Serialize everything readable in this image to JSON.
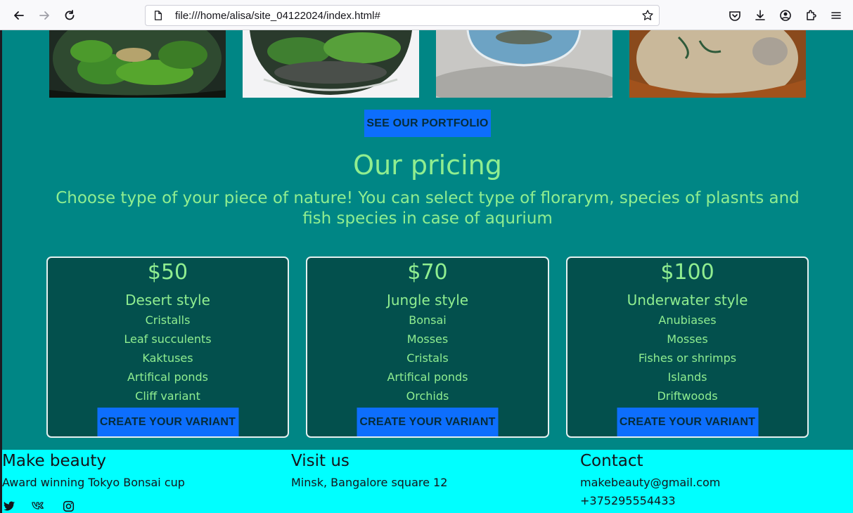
{
  "browser": {
    "url": "file:///home/alisa/site_04122024/index.html#"
  },
  "portfolio": {
    "button_label": "SEE OUR PORTFOLIO"
  },
  "pricing": {
    "title": "Our pricing",
    "subtitle": "Choose type of your piece of nature! You can select type of florarym, species of plasnts and fish species in case of aqurium",
    "cards": [
      {
        "price": "$50",
        "style": "Desert style",
        "features": [
          "Cristalls",
          "Leaf succulents",
          "Kaktuses",
          "Artifical ponds",
          "Cliff variant"
        ],
        "button": "CREATE YOUR VARIANT"
      },
      {
        "price": "$70",
        "style": "Jungle style",
        "features": [
          "Bonsai",
          "Mosses",
          "Cristals",
          "Artifical ponds",
          "Orchids"
        ],
        "button": "CREATE YOUR VARIANT"
      },
      {
        "price": "$100",
        "style": "Underwater style",
        "features": [
          "Anubiases",
          "Mosses",
          "Fishes or shrimps",
          "Islands",
          "Driftwoods"
        ],
        "button": "CREATE YOUR VARIANT"
      }
    ]
  },
  "footer": {
    "col1": {
      "title": "Make beauty",
      "text": "Award winning Tokyo Bonsai cup"
    },
    "col2": {
      "title": "Visit us",
      "text": "Minsk, Bangalore square 12"
    },
    "col3": {
      "title": "Contact",
      "email": "makebeauty@gmail.com",
      "phone": "+375295554433"
    },
    "social": [
      "twitter-icon",
      "vk-icon",
      "instagram-icon"
    ]
  },
  "colors": {
    "page_bg": "#008685",
    "card_bg": "#03504d",
    "accent_text": "#90ee90",
    "button": "#0d6efd",
    "footer_bg": "#00ffff"
  }
}
